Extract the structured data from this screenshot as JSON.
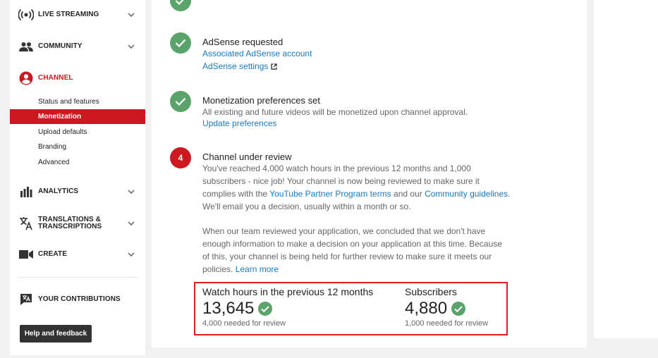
{
  "sidebar": {
    "sections": [
      {
        "label": "LIVE STREAMING",
        "icon": "live-streaming-icon"
      },
      {
        "label": "COMMUNITY",
        "icon": "community-icon"
      },
      {
        "label": "CHANNEL",
        "icon": "channel-icon"
      },
      {
        "label": "ANALYTICS",
        "icon": "analytics-icon"
      },
      {
        "label_line1": "TRANSLATIONS &",
        "label_line2": "TRANSCRIPTIONS",
        "icon": "translate-icon"
      },
      {
        "label": "CREATE",
        "icon": "camera-icon"
      },
      {
        "label": "YOUR CONTRIBUTIONS",
        "icon": "contributions-icon"
      }
    ],
    "channel_items": [
      "Status and features",
      "Monetization",
      "Upload defaults",
      "Branding",
      "Advanced"
    ],
    "active_item": "Monetization",
    "help_button": "Help and feedback"
  },
  "steps": {
    "adsense": {
      "title": "AdSense requested",
      "link1": "Associated AdSense account",
      "link2": "AdSense settings"
    },
    "monetization": {
      "title": "Monetization preferences set",
      "desc": "All existing and future videos will be monetized upon channel approval.",
      "link": "Update preferences"
    },
    "review": {
      "number": "4",
      "title": "Channel under review",
      "para1_a": "You've reached 4,000 watch hours in the previous 12 months and 1,000",
      "para1_b": "subscribers - nice job! Your channel is now being reviewed to make sure it",
      "para1_c": "complies with the ",
      "para1_link1": "YouTube Partner Program terms",
      "para1_d": " and our ",
      "para1_link2": "Community guidelines",
      "para1_e": ".",
      "para1_f": "We'll email you a decision, usually within a month or so.",
      "para2_a": "When our team reviewed your application, we concluded that we don't have",
      "para2_b": "enough information to make a decision on your application at this time. Because",
      "para2_c": "of this, your channel is being held for further review to make sure it meets our",
      "para2_d": "policies. ",
      "para2_link": "Learn more"
    }
  },
  "stats": {
    "watch_hours": {
      "label": "Watch hours in the previous 12 months",
      "value": "13,645",
      "note": "4,000 needed for review"
    },
    "subscribers": {
      "label": "Subscribers",
      "value": "4,880",
      "note": "1,000 needed for review"
    }
  },
  "colors": {
    "accent_red": "#cc181e",
    "check_green": "#5aa36a",
    "link_blue": "#167ac6",
    "highlight_border": "#e02020"
  }
}
